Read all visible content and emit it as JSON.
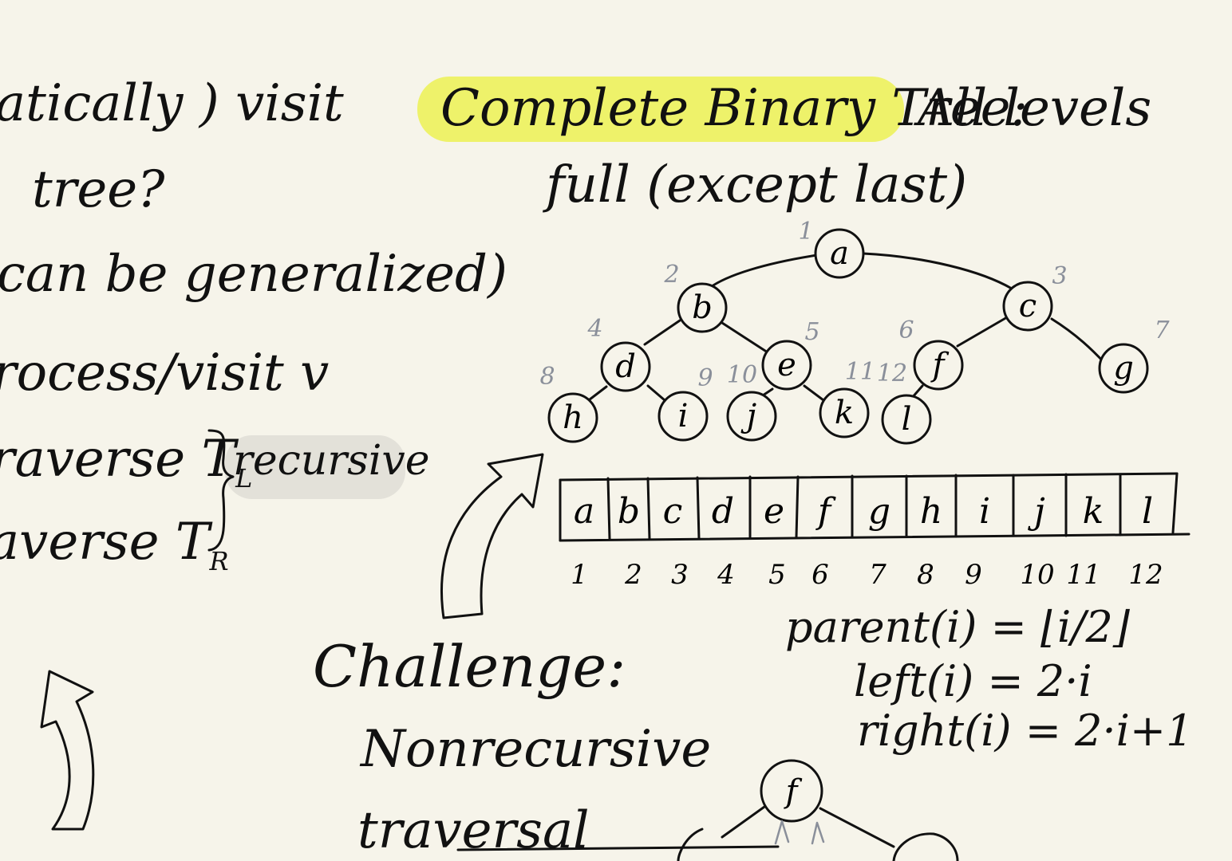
{
  "left_notes": {
    "line1": "atically ) visit",
    "line2": "tree?",
    "line3": "can be generalized)",
    "line4": "rocess/visit v",
    "line5": "raverse T",
    "line5_sub": "L",
    "line6": "averse T",
    "line6_sub": "R",
    "recursive": "recursive"
  },
  "title": {
    "highlighted": "Complete Binary Tree:",
    "rest": "All levels",
    "line2": "full (except last)"
  },
  "tree": {
    "nodes": [
      {
        "label": "a",
        "index": "1"
      },
      {
        "label": "b",
        "index": "2"
      },
      {
        "label": "c",
        "index": "3"
      },
      {
        "label": "d",
        "index": "4"
      },
      {
        "label": "e",
        "index": "5"
      },
      {
        "label": "f",
        "index": "6"
      },
      {
        "label": "g",
        "index": "7"
      },
      {
        "label": "h",
        "index": "8"
      },
      {
        "label": "i",
        "index": "9"
      },
      {
        "label": "j",
        "index": "10"
      },
      {
        "label": "k",
        "index": "11"
      },
      {
        "label": "l",
        "index": "12"
      }
    ]
  },
  "array": {
    "cells": [
      "a",
      "b",
      "c",
      "d",
      "e",
      "f",
      "g",
      "h",
      "i",
      "j",
      "k",
      "l"
    ],
    "indices": [
      "1",
      "2",
      "3",
      "4",
      "5",
      "6",
      "7",
      "8",
      "9",
      "10",
      "11",
      "12"
    ]
  },
  "formulas": {
    "parent": "parent(i) = ⌊i/2⌋",
    "left": "left(i) = 2·i",
    "right": "right(i) = 2·i+1"
  },
  "challenge": {
    "heading": "Challenge:",
    "line2": "Nonrecursive",
    "line3": "traversal"
  },
  "bottom_tree": {
    "root": "f"
  },
  "colors": {
    "background": "#f6f4ea",
    "highlight_yellow": "#eef26a",
    "highlight_gray": "#e3e1d9",
    "ink": "#111111",
    "index_gray": "#8a8f9a"
  }
}
